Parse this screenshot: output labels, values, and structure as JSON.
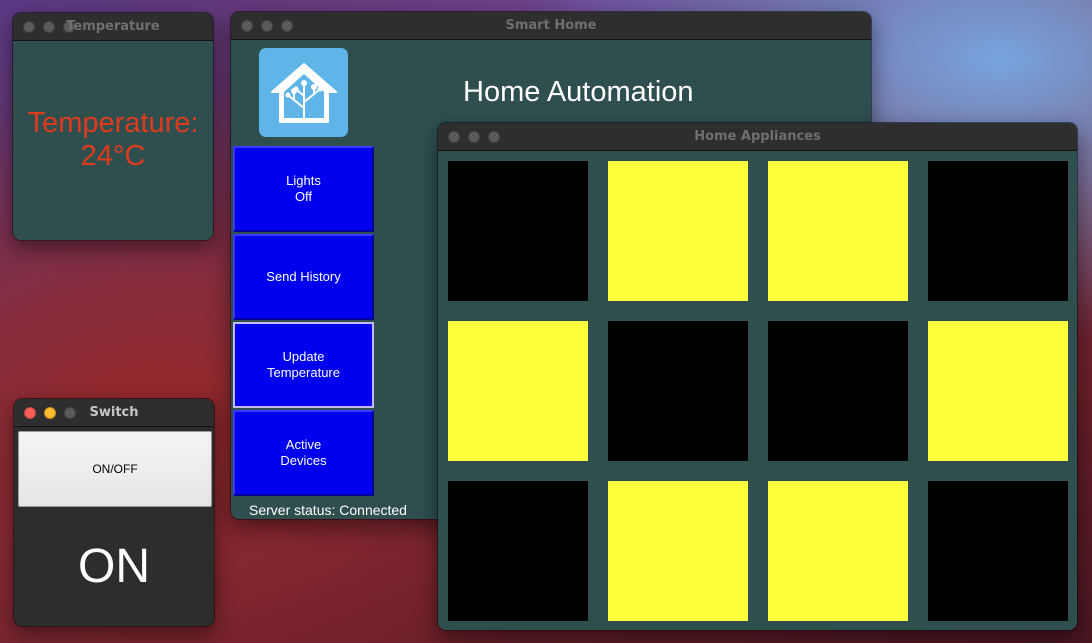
{
  "temperature_window": {
    "title": "Temperature",
    "reading": "Temperature:\n24°C"
  },
  "switch_window": {
    "title": "Switch",
    "button_label": "ON/OFF",
    "state": "ON"
  },
  "smart_home_window": {
    "title": "Smart Home",
    "heading": "Home Automation",
    "buttons": [
      {
        "label": "Lights\nOff"
      },
      {
        "label": "Send History"
      },
      {
        "label": "Update\nTemperature"
      },
      {
        "label": "Active\nDevices"
      }
    ],
    "server_status": "Server status: Connected"
  },
  "appliances_window": {
    "title": "Home Appliances",
    "tiles": [
      [
        "off",
        "on",
        "on",
        "off"
      ],
      [
        "on",
        "off",
        "off",
        "on"
      ],
      [
        "off",
        "on",
        "on",
        "off"
      ]
    ]
  },
  "colors": {
    "window_bg": "#2f4f4f",
    "button_blue": "#0000ee",
    "tile_on": "#ffff3b",
    "tile_off": "#000000",
    "temperature_text": "#e03a1e"
  }
}
